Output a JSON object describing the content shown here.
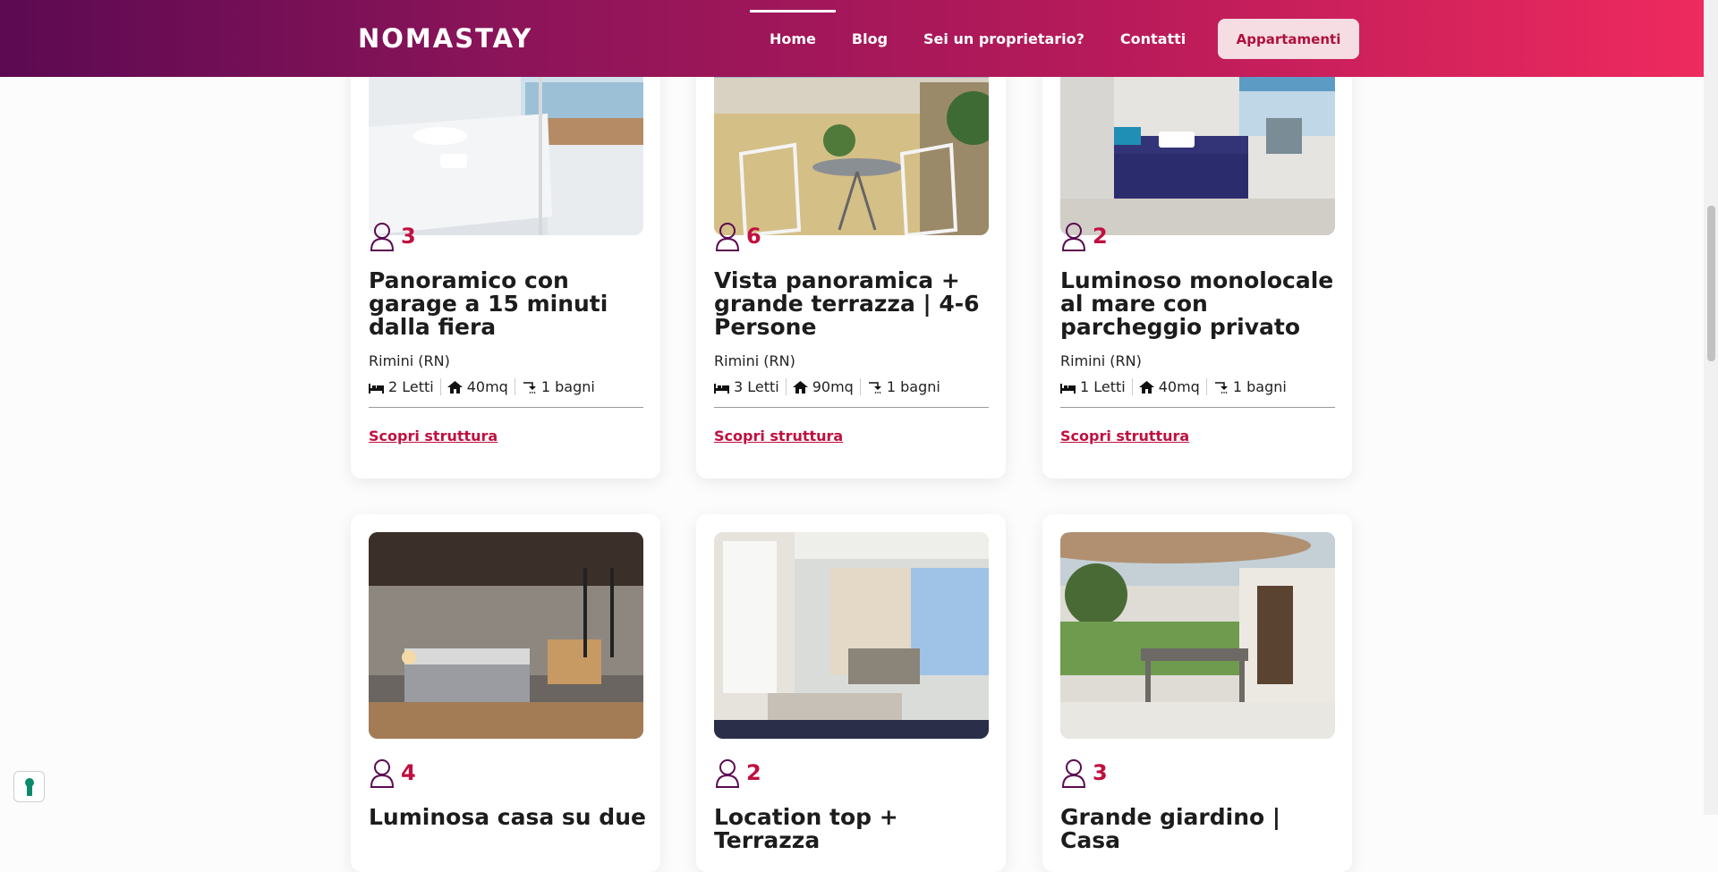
{
  "header": {
    "logo": "NOMASTAY",
    "nav": [
      "Home",
      "Blog",
      "Sei un proprietario?",
      "Contatti"
    ],
    "cta": "Appartamenti"
  },
  "cards": [
    {
      "guests": "3",
      "title": "Panoramico con garage a 15 minuti dalla fiera",
      "city": "Rimini (RN)",
      "beds": "2 Letti",
      "size": "40mq",
      "baths": "1 bagni",
      "link": "Scopri struttura"
    },
    {
      "guests": "6",
      "title": "Vista panoramica + grande terrazza | 4-6 Persone",
      "city": "Rimini (RN)",
      "beds": "3 Letti",
      "size": "90mq",
      "baths": "1 bagni",
      "link": "Scopri struttura"
    },
    {
      "guests": "2",
      "title": "Luminoso monolocale al mare con parcheggio privato",
      "city": "Rimini (RN)",
      "beds": "1 Letti",
      "size": "40mq",
      "baths": "1 bagni",
      "link": "Scopri struttura"
    },
    {
      "guests": "4",
      "title": "Luminosa casa su due"
    },
    {
      "guests": "2",
      "title": "Location top + Terrazza"
    },
    {
      "guests": "3",
      "title": "Grande giardino | Casa"
    }
  ],
  "colors": {
    "accent": "#c0103f",
    "header_start": "#5c0a52",
    "header_end": "#ee2a5e"
  }
}
